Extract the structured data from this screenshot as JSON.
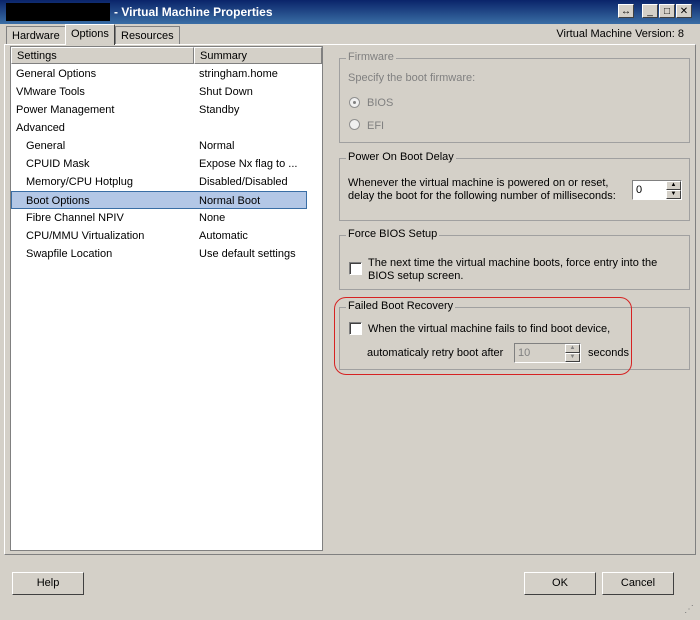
{
  "window": {
    "title": "- Virtual Machine Properties",
    "vm_version": "Virtual Machine Version: 8"
  },
  "tabs": [
    {
      "label": "Hardware"
    },
    {
      "label": "Options"
    },
    {
      "label": "Resources"
    }
  ],
  "list": {
    "headers": [
      "Settings",
      "Summary"
    ],
    "rows": [
      {
        "setting": "General Options",
        "summary": "stringham.home"
      },
      {
        "setting": "VMware Tools",
        "summary": "Shut Down"
      },
      {
        "setting": "Power Management",
        "summary": "Standby"
      },
      {
        "setting": "Advanced",
        "summary": ""
      },
      {
        "setting": "General",
        "summary": "Normal"
      },
      {
        "setting": "CPUID Mask",
        "summary": "Expose Nx flag to ..."
      },
      {
        "setting": "Memory/CPU Hotplug",
        "summary": "Disabled/Disabled"
      },
      {
        "setting": "Boot Options",
        "summary": "Normal Boot"
      },
      {
        "setting": "Fibre Channel NPIV",
        "summary": "None"
      },
      {
        "setting": "CPU/MMU Virtualization",
        "summary": "Automatic"
      },
      {
        "setting": "Swapfile Location",
        "summary": "Use default settings"
      }
    ],
    "selected_index": 7
  },
  "firmware": {
    "legend": "Firmware",
    "prompt": "Specify the boot firmware:",
    "bios": "BIOS",
    "efi": "EFI"
  },
  "boot_delay": {
    "legend": "Power On Boot Delay",
    "line1": "Whenever the virtual machine is powered on or reset,",
    "line2": "delay the boot for the following number of milliseconds:",
    "value": "0"
  },
  "force_bios": {
    "legend": "Force BIOS Setup",
    "line1": "The next time the virtual machine boots, force entry into the",
    "line2": "BIOS setup screen."
  },
  "failed_boot": {
    "legend": "Failed Boot Recovery",
    "line1": "When the virtual machine fails to find boot device,",
    "line2": "automaticaly retry boot after",
    "value": "10",
    "unit": "seconds"
  },
  "buttons": {
    "help": "Help",
    "ok": "OK",
    "cancel": "Cancel"
  },
  "colors": {
    "accent": "#0a246a",
    "selection": "#b3c7e6",
    "highlight_ring": "#d62222"
  }
}
